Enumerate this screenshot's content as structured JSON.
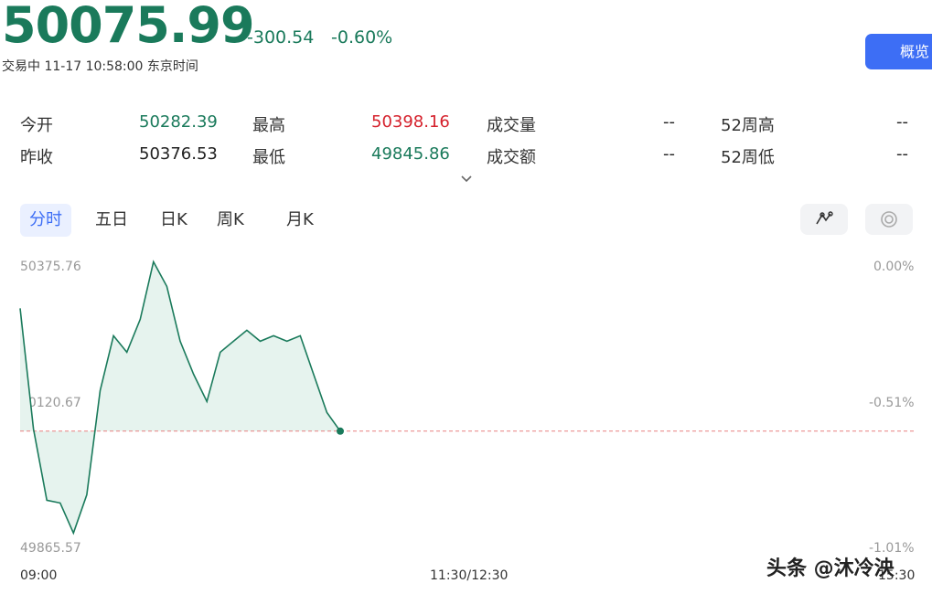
{
  "header": {
    "price": "50075.99",
    "change": "-300.54",
    "change_pct": "-0.60%",
    "status": "交易中 11-17 10:58:00 东京时间",
    "overview_button": "概览"
  },
  "stats": {
    "open_label": "今开",
    "open_value": "50282.39",
    "high_label": "最高",
    "high_value": "50398.16",
    "volume_label": "成交量",
    "volume_value": "--",
    "w52_high_label": "52周高",
    "w52_high_value": "--",
    "prev_close_label": "昨收",
    "prev_close_value": "50376.53",
    "low_label": "最低",
    "low_value": "49845.86",
    "amount_label": "成交额",
    "amount_value": "--",
    "w52_low_label": "52周低",
    "w52_low_value": "--"
  },
  "tabs": [
    "分时",
    "五日",
    "日K",
    "周K",
    "月K"
  ],
  "chart_axis": {
    "y_left": [
      "50375.76",
      "50120.67",
      "49865.57"
    ],
    "y_right": [
      "0.00%",
      "-0.51%",
      "-1.01%"
    ],
    "x": [
      "09:00",
      "11:30/12:30",
      "15:30"
    ]
  },
  "chart_data": {
    "type": "area",
    "ylim": [
      49865.57,
      50375.76
    ],
    "reference_line": 50075.99,
    "x": [
      "09:00",
      "09:05",
      "09:10",
      "09:15",
      "09:20",
      "09:25",
      "09:30",
      "09:35",
      "09:40",
      "09:45",
      "09:50",
      "09:55",
      "10:00",
      "10:05",
      "10:10",
      "10:15",
      "10:20",
      "10:25",
      "10:30",
      "10:35",
      "10:40",
      "10:45",
      "10:50",
      "10:55",
      "10:58"
    ],
    "values": [
      50300,
      50080,
      49950,
      49945,
      49890,
      49960,
      50150,
      50250,
      50220,
      50280,
      50385,
      50340,
      50240,
      50180,
      50130,
      50220,
      50240,
      50260,
      50240,
      50250,
      50240,
      50250,
      50180,
      50110,
      50076
    ]
  },
  "colors": {
    "accent_green": "#1a7a5b",
    "accent_red": "#d5212c",
    "accent_blue": "#3d6ef5",
    "area_fill": "#e6f3ee"
  },
  "watermark": "头条 @沐冷泱",
  "icons": {
    "draw_tool": "draw-tool-icon",
    "indicator": "indicator-icon",
    "chevron": "chevron-down-icon"
  }
}
